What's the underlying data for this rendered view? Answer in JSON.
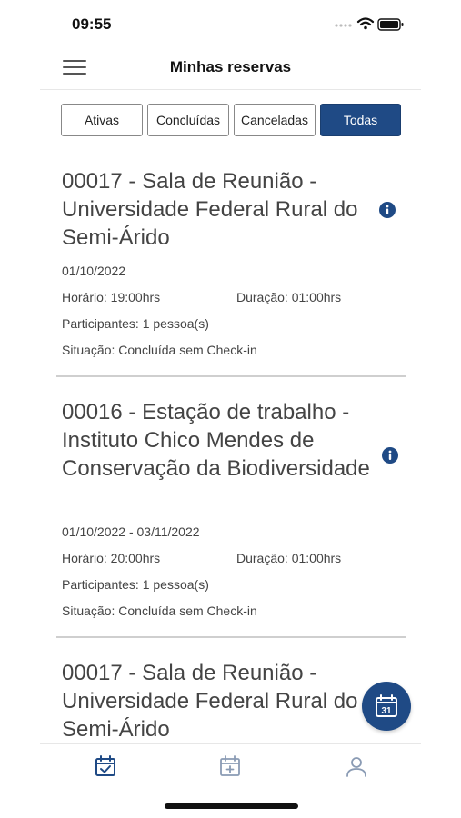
{
  "status_bar": {
    "time": "09:55",
    "icons": [
      "signal-icon",
      "wifi-icon",
      "battery-icon"
    ]
  },
  "header": {
    "title": "Minhas reservas",
    "menu_icon": "hamburger-icon"
  },
  "filters": [
    {
      "label": "Ativas",
      "active": false
    },
    {
      "label": "Concluídas",
      "active": false
    },
    {
      "label": "Canceladas",
      "active": false
    },
    {
      "label": "Todas",
      "active": true
    }
  ],
  "reservations": [
    {
      "title": "00017 - Sala de Reunião - Universidade Federal Rural do Semi-Árido",
      "date": "01/10/2022",
      "horario": "Horário: 19:00hrs",
      "duracao": "Duração: 01:00hrs",
      "participantes": "Participantes: 1 pessoa(s)",
      "situacao": "Situação: Concluída sem Check-in"
    },
    {
      "title": "00016 - Estação de trabalho - Instituto Chico Mendes de Conservação da Biodiversidade",
      "date": "01/10/2022 - 03/11/2022",
      "horario": "Horário: 20:00hrs",
      "duracao": "Duração: 01:00hrs",
      "participantes": "Participantes: 1 pessoa(s)",
      "situacao": "Situação: Concluída sem Check-in"
    },
    {
      "title": "00017 - Sala de Reunião - Universidade Federal Rural do Semi-Árido"
    }
  ],
  "fab": {
    "icon": "calendar-icon",
    "label": "31"
  },
  "tab_bar": {
    "items": [
      "calendar-check-icon",
      "calendar-add-icon",
      "user-icon"
    ]
  },
  "colors": {
    "primary": "#1f4a85",
    "text": "#444444",
    "divider": "#cfcfcf"
  }
}
